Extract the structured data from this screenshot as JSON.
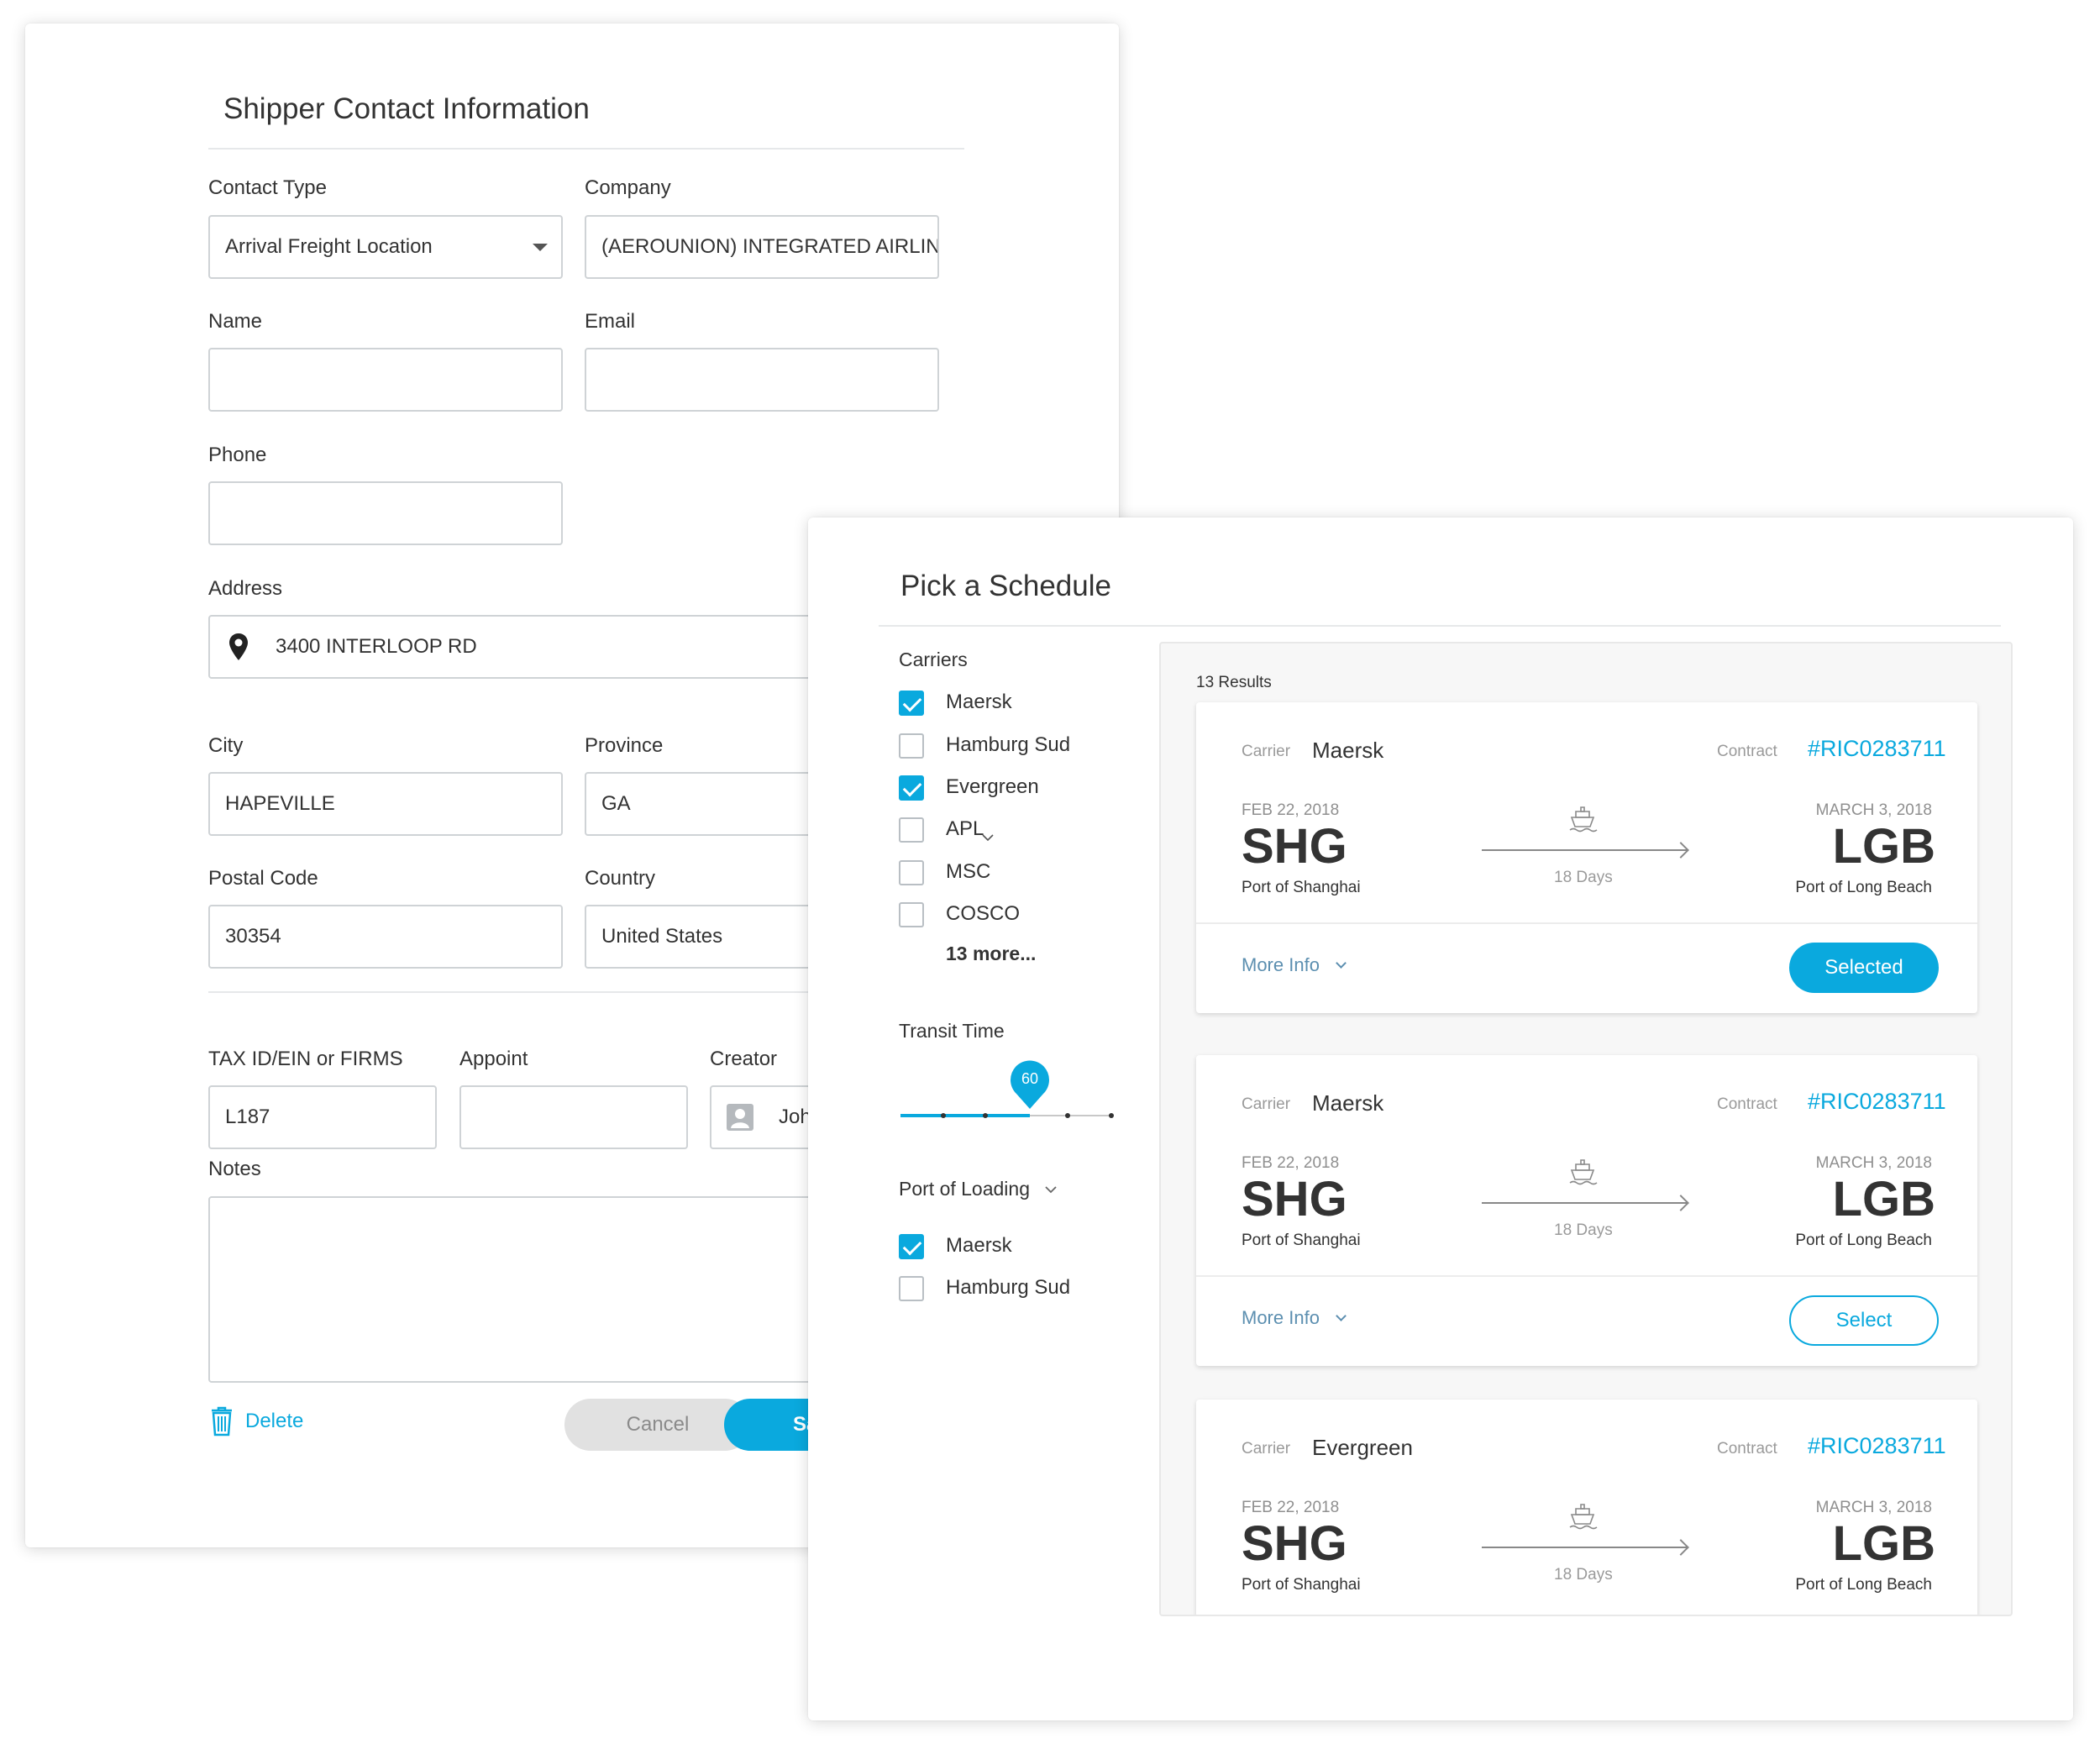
{
  "contact_form": {
    "title": "Shipper Contact Information",
    "contact_type": {
      "label": "Contact Type",
      "value": "Arrival Freight Location"
    },
    "company": {
      "label": "Company",
      "value": "(AEROUNION) INTEGRATED AIRLINE"
    },
    "name": {
      "label": "Name",
      "value": ""
    },
    "email": {
      "label": "Email",
      "value": ""
    },
    "phone": {
      "label": "Phone",
      "value": ""
    },
    "address": {
      "label": "Address",
      "value": "3400 INTERLOOP RD"
    },
    "city": {
      "label": "City",
      "value": "HAPEVILLE"
    },
    "province": {
      "label": "Province",
      "value": "GA"
    },
    "postal_code": {
      "label": "Postal Code",
      "value": "30354"
    },
    "country": {
      "label": "Country",
      "value": "United States"
    },
    "tax_id": {
      "label": "TAX ID/EIN or FIRMS",
      "value": "L187"
    },
    "appoint": {
      "label": "Appoint",
      "value": ""
    },
    "creator": {
      "label": "Creator",
      "value": "Joh"
    },
    "notes": {
      "label": "Notes",
      "value": ""
    },
    "delete_label": "Delete",
    "cancel_label": "Cancel",
    "save_label": "Save"
  },
  "schedule": {
    "title": "Pick a Schedule",
    "carriers_label": "Carriers",
    "carriers": [
      {
        "name": "Maersk",
        "checked": true
      },
      {
        "name": "Hamburg Sud",
        "checked": false
      },
      {
        "name": "Evergreen",
        "checked": true
      },
      {
        "name": "APL",
        "checked": false
      },
      {
        "name": "MSC",
        "checked": false
      },
      {
        "name": "COSCO",
        "checked": false
      }
    ],
    "more_carriers": "13 more...",
    "transit_label": "Transit Time",
    "transit_value": "60",
    "port_loading_label": "Port of Loading",
    "port_loading": [
      {
        "name": "Maersk",
        "checked": true
      },
      {
        "name": "Hamburg Sud",
        "checked": false
      }
    ],
    "results_count": "13 Results",
    "results": [
      {
        "carrier_label": "Carrier",
        "carrier": "Maersk",
        "contract_label": "Contract",
        "contract": "#RIC0283711",
        "depart_date": "FEB 22, 2018",
        "origin_code": "SHG",
        "origin_port": "Port of Shanghai",
        "duration": "18 Days",
        "arrive_date": "MARCH 3, 2018",
        "dest_code": "LGB",
        "dest_port": "Port of Long Beach",
        "more_info": "More Info",
        "action": "Selected"
      },
      {
        "carrier_label": "Carrier",
        "carrier": "Maersk",
        "contract_label": "Contract",
        "contract": "#RIC0283711",
        "depart_date": "FEB 22, 2018",
        "origin_code": "SHG",
        "origin_port": "Port of Shanghai",
        "duration": "18 Days",
        "arrive_date": "MARCH 3, 2018",
        "dest_code": "LGB",
        "dest_port": "Port of Long Beach",
        "more_info": "More Info",
        "action": "Select"
      },
      {
        "carrier_label": "Carrier",
        "carrier": "Evergreen",
        "contract_label": "Contract",
        "contract": "#RIC0283711",
        "depart_date": "FEB 22, 2018",
        "origin_code": "SHG",
        "origin_port": "Port of Shanghai",
        "duration": "18 Days",
        "arrive_date": "MARCH 3, 2018",
        "dest_code": "LGB",
        "dest_port": "Port of Long Beach"
      }
    ]
  },
  "colors": {
    "accent": "#0aa9de",
    "border": "#cfd3d6",
    "muted": "#9a9a9a"
  },
  "icons": [
    "chevron-down-icon",
    "location-pin-icon",
    "user-avatar-icon",
    "trash-icon",
    "checkbox-icon",
    "ship-icon",
    "arrow-right-icon"
  ]
}
